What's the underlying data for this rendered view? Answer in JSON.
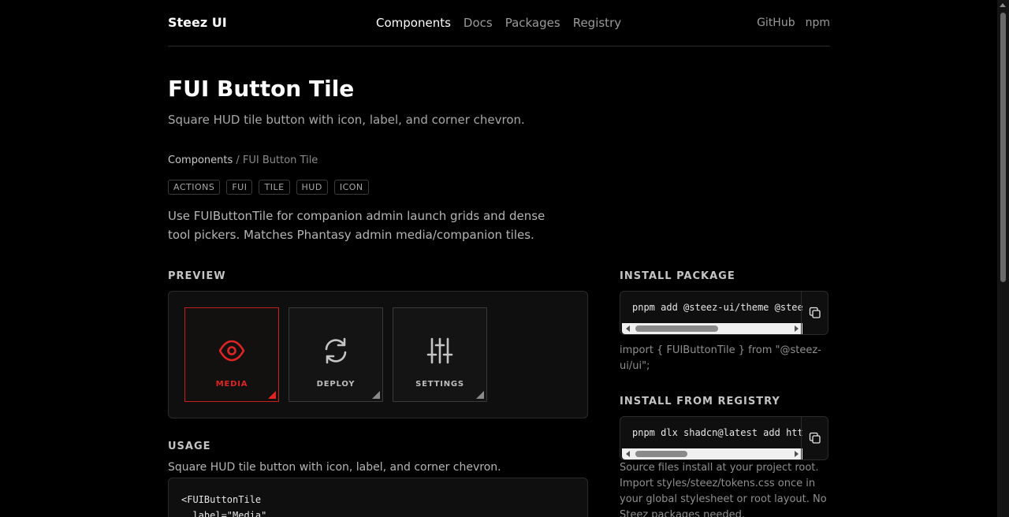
{
  "brand": "Steez UI",
  "nav": [
    "Components",
    "Docs",
    "Packages",
    "Registry"
  ],
  "ext_links": [
    "GitHub",
    "npm"
  ],
  "title": "FUI Button Tile",
  "subtitle": "Square HUD tile button with icon, label, and corner chevron.",
  "breadcrumb": {
    "root": "Components",
    "sep": " / ",
    "current": "FUI Button Tile"
  },
  "tags": [
    "ACTIONS",
    "FUI",
    "TILE",
    "HUD",
    "ICON"
  ],
  "description": "Use FUIButtonTile for companion admin launch grids and dense tool pickers. Matches Phantasy admin media/companion tiles.",
  "preview": {
    "label": "PREVIEW",
    "tiles": [
      {
        "label": "MEDIA",
        "icon": "eye-icon",
        "active": true
      },
      {
        "label": "DEPLOY",
        "icon": "refresh-icon",
        "active": false
      },
      {
        "label": "SETTINGS",
        "icon": "sliders-icon",
        "active": false
      }
    ]
  },
  "usage": {
    "label": "USAGE",
    "description": "Square HUD tile button with icon, label, and corner chevron.",
    "code_lines": [
      "<FUIButtonTile",
      "  label=\"Media\""
    ]
  },
  "install_package": {
    "label": "INSTALL PACKAGE",
    "command": "pnpm add @steez-ui/theme @steez-ui/ui",
    "import_note": "import { FUIButtonTile } from \"@steez-ui/ui\";"
  },
  "install_registry": {
    "label": "INSTALL FROM REGISTRY",
    "command": "pnpm dlx shadcn@latest add https://",
    "note": "Source files install at your project root. Import styles/steez/tokens.css once in your global stylesheet or root layout. No Steez packages needed."
  },
  "colors": {
    "accent": "#e02424",
    "background": "#000000",
    "panel": "#0f0f0f"
  }
}
